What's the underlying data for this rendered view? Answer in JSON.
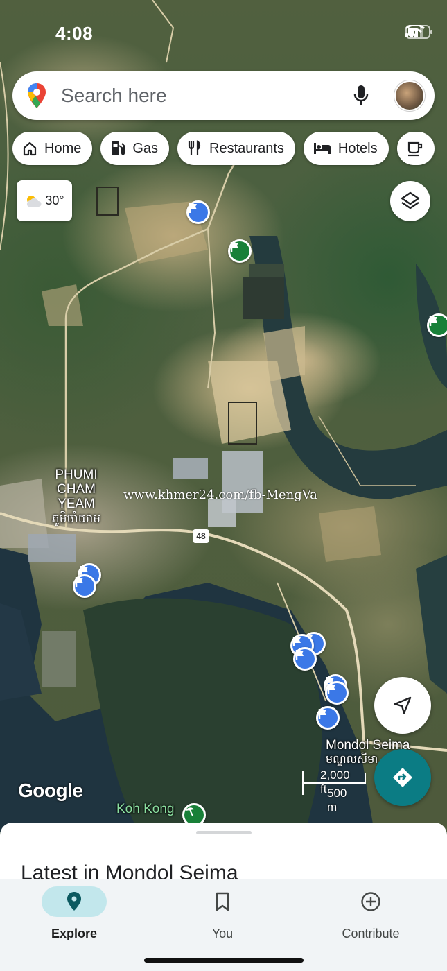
{
  "status_bar": {
    "time": "4:08"
  },
  "search": {
    "placeholder": "Search here"
  },
  "chips": [
    {
      "label": "Home",
      "icon": "home-icon"
    },
    {
      "label": "Gas",
      "icon": "gas-station-icon"
    },
    {
      "label": "Restaurants",
      "icon": "restaurant-icon"
    },
    {
      "label": "Hotels",
      "icon": "hotel-bed-icon"
    }
  ],
  "weather": {
    "temp": "30°",
    "icon": "partly-cloudy-icon"
  },
  "map": {
    "labels": {
      "phumi_line1": "PHUMI",
      "phumi_line2": "CHAM YEAM",
      "phumi_khmer": "ភូមិចាំយាម",
      "mondol": "Mondol Seima",
      "mondol_khmer": "មណ្ឌលសីមា",
      "koh_kong": "Koh Kong"
    },
    "route_number": "48",
    "watermark": "www.khmer24.com/fb-MengVa",
    "attribution": "Google",
    "scale": {
      "feet": "2,000 ft",
      "meters": "500 m"
    }
  },
  "sheet": {
    "title": "Latest in Mondol Seima"
  },
  "nav": {
    "explore": "Explore",
    "you": "You",
    "contribute": "Contribute"
  },
  "colors": {
    "accent_teal": "#0b7c84",
    "pin_blue": "#3b78e7",
    "pin_green": "#188038",
    "explore_active_bg": "#c2e7ec"
  }
}
